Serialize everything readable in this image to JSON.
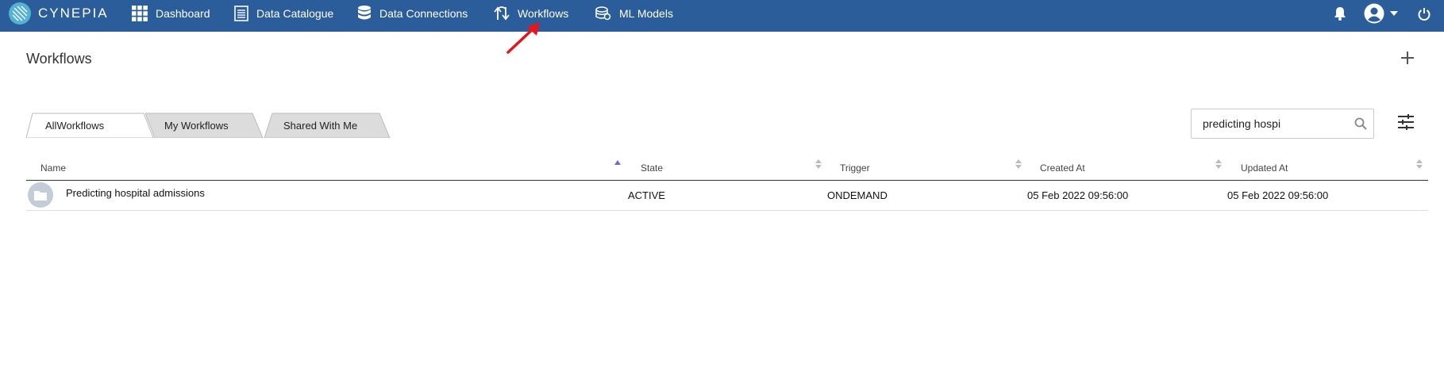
{
  "brand": {
    "name": "CYNEPIA"
  },
  "nav": {
    "items": [
      {
        "label": "Dashboard",
        "icon": "grid-icon"
      },
      {
        "label": "Data Catalogue",
        "icon": "document-icon"
      },
      {
        "label": "Data Connections",
        "icon": "database-icon"
      },
      {
        "label": "Workflows",
        "icon": "workflow-icon"
      },
      {
        "label": "ML Models",
        "icon": "ml-models-icon"
      }
    ]
  },
  "header_icons": [
    "bell-icon",
    "user-avatar-icon",
    "chevron-down-icon",
    "power-icon"
  ],
  "page": {
    "title": "Workflows"
  },
  "tabs": [
    {
      "label": "AllWorkflows",
      "active": true
    },
    {
      "label": "My Workflows",
      "active": false
    },
    {
      "label": "Shared With Me",
      "active": false
    }
  ],
  "search": {
    "value": "predicting hospi"
  },
  "table": {
    "columns": [
      "Name",
      "State",
      "Trigger",
      "Created At",
      "Updated At"
    ],
    "rows": [
      {
        "name": "Predicting hospital admissions",
        "state": "ACTIVE",
        "trigger": "ONDEMAND",
        "created_at": "05 Feb 2022 09:56:00",
        "updated_at": "05 Feb 2022 09:56:00"
      }
    ]
  },
  "colors": {
    "topbar": "#2a5d9a",
    "annotation_arrow": "#e8141c",
    "sort_active": "#6b6fc8"
  }
}
